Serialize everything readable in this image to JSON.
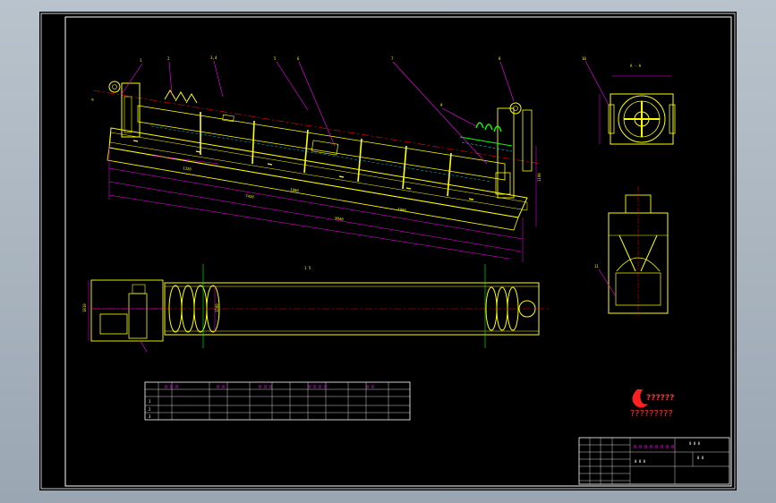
{
  "colors": {
    "background": "#000000",
    "frame": "#ffffff",
    "outline": "#ffff00",
    "centerline": "#ff0000",
    "leader": "#ff00ff",
    "dimension": "#ff00ff",
    "hidden": "#00ffff",
    "spiral": "#00ff00",
    "logo": "#ff2020"
  },
  "logo": {
    "icon": "flame-logo-icon",
    "caption": "?????????",
    "mark": "??????"
  },
  "side_view": {
    "label": "1 5"
  },
  "plan_view": {
    "label": "1 5"
  },
  "section_a": {
    "label": "A - A"
  },
  "notes": {
    "weight": "65t",
    "n1": "1",
    "n2": "2",
    "n3": "3"
  }
}
